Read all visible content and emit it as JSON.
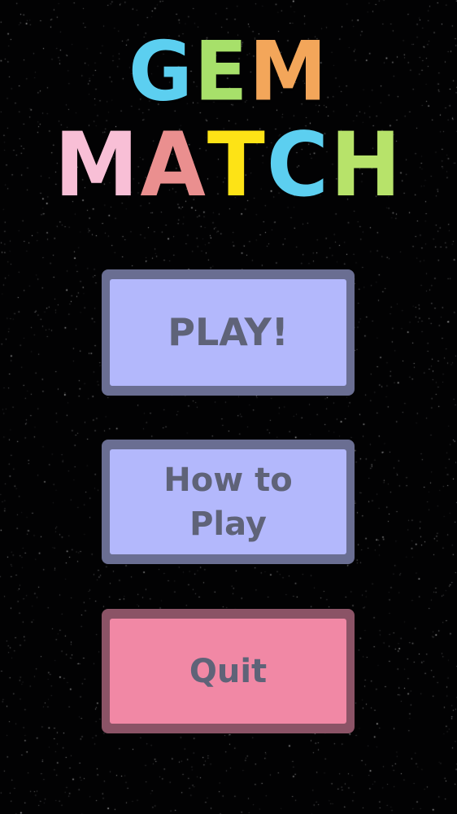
{
  "title": {
    "line1": [
      {
        "char": "G",
        "color": "#5ccff0"
      },
      {
        "char": "E",
        "color": "#a7e06a"
      },
      {
        "char": "M",
        "color": "#f3a65a"
      }
    ],
    "line2": [
      {
        "char": "M",
        "color": "#f8bfd6"
      },
      {
        "char": "A",
        "color": "#ea8f8f"
      },
      {
        "char": "T",
        "color": "#fde316"
      },
      {
        "char": "C",
        "color": "#5ccff0"
      },
      {
        "char": "H",
        "color": "#b7e36a"
      }
    ]
  },
  "menu": {
    "play_label": "PLAY!",
    "howto_label": "How to\nPlay",
    "quit_label": "Quit"
  },
  "colors": {
    "background": "#020203",
    "button_fill": "#b3b8fc",
    "button_border": "#6a6e92",
    "button_text": "#5f6378",
    "quit_fill": "#f188a5",
    "quit_border": "#8b5366",
    "quit_text": "#5f6378"
  }
}
